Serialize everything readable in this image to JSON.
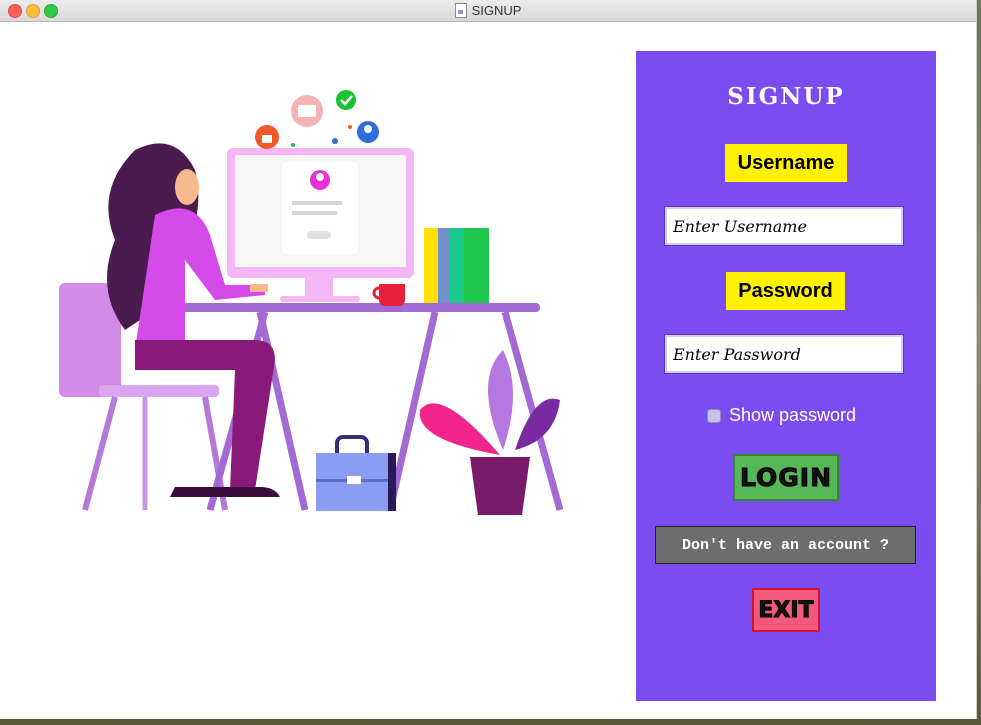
{
  "window": {
    "title": "SIGNUP"
  },
  "form": {
    "heading": "SIGNUP",
    "username_label": "Username",
    "username_placeholder": "Enter Username",
    "password_label": "Password",
    "password_placeholder": "Enter Password",
    "show_password_label": "Show password",
    "show_password_checked": false,
    "login_label": "LOGIN",
    "account_label": "Don't have an account ?",
    "exit_label": "EXIT"
  },
  "icons": [
    "close-icon",
    "minimize-icon",
    "maximize-icon",
    "document-icon"
  ],
  "colors": {
    "panel": "#7b4cf0",
    "label_badge": "#fff200",
    "login_button": "#57b857",
    "account_button": "#6d6d6d",
    "exit_button": "#f35a7a"
  }
}
